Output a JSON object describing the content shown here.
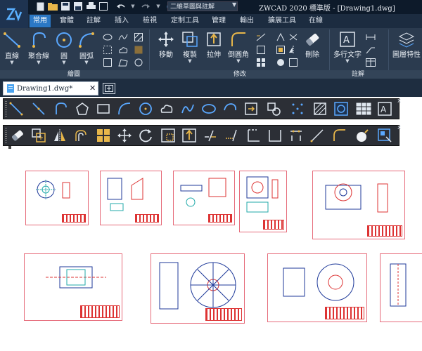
{
  "window": {
    "workspace": "二維草圖與註解",
    "title": "ZWCAD 2020 標準版 - [Drawing1.dwg]"
  },
  "ribbon_tabs": [
    {
      "label": "常用",
      "active": true
    },
    {
      "label": "實體",
      "active": false
    },
    {
      "label": "註解",
      "active": false
    },
    {
      "label": "插入",
      "active": false
    },
    {
      "label": "檢視",
      "active": false
    },
    {
      "label": "定制工具",
      "active": false
    },
    {
      "label": "管理",
      "active": false
    },
    {
      "label": "輸出",
      "active": false
    },
    {
      "label": "擴展工具",
      "active": false
    },
    {
      "label": "在線",
      "active": false
    }
  ],
  "draw_panel": {
    "title": "繪圖",
    "buttons": [
      {
        "label": "直線",
        "icon": "line-icon"
      },
      {
        "label": "聚合線",
        "icon": "polyline-icon"
      },
      {
        "label": "圓",
        "icon": "circle-icon"
      },
      {
        "label": "圓弧",
        "icon": "arc-icon"
      }
    ]
  },
  "modify_panel": {
    "title": "修改",
    "buttons": [
      {
        "label": "移動",
        "icon": "move-icon"
      },
      {
        "label": "複製",
        "icon": "copy-icon"
      },
      {
        "label": "拉伸",
        "icon": "stretch-icon"
      },
      {
        "label": "倒圓角",
        "icon": "fillet-icon"
      },
      {
        "label": "刪除",
        "icon": "erase-icon"
      }
    ]
  },
  "annotate_panel": {
    "title": "註解",
    "buttons": [
      {
        "label": "多行文字",
        "icon": "mtext-icon"
      }
    ]
  },
  "properties_panel": {
    "buttons": [
      {
        "label": "圖層特性",
        "icon": "layer-properties-icon"
      }
    ]
  },
  "document_tab": {
    "label": "Drawing1.dwg*"
  },
  "colors": {
    "accent": "#2b78c5",
    "title_bg": "#0d1a2a",
    "ribbon_bg": "#2b3b4f",
    "toolbar_bg": "#2c2f36",
    "icon_blue": "#5aa8ff",
    "icon_gold": "#e7b64a",
    "sheet_border": "#e66b7a"
  }
}
